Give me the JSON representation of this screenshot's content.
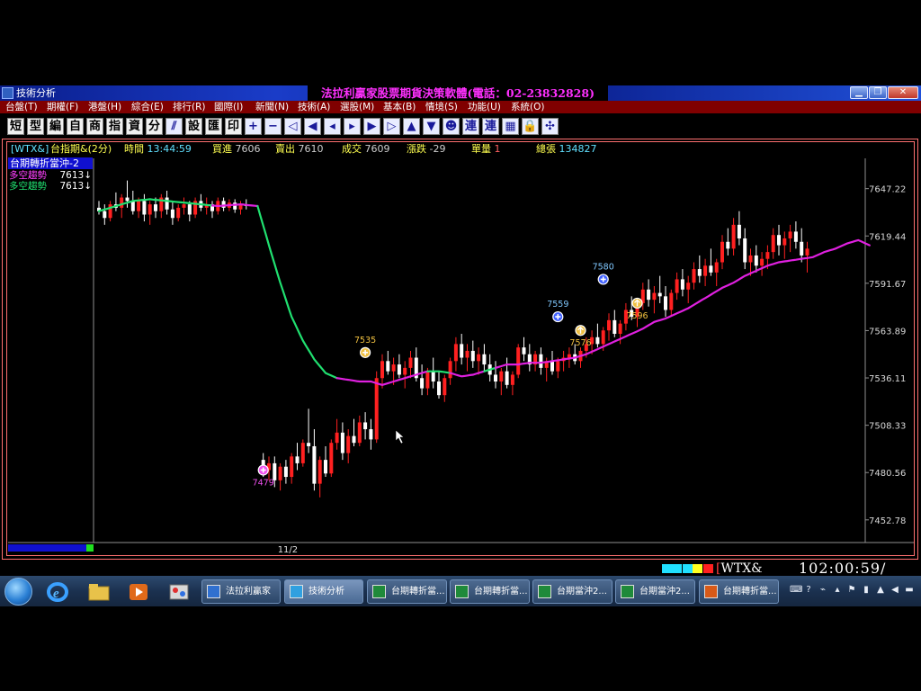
{
  "window": {
    "title": "技術分析",
    "banner": "法拉利贏家股票期貨決策軟體(電話：02-23832828)"
  },
  "menu": [
    "台盤(T)",
    "期權(F)",
    "港盤(H)",
    "綜合(E)",
    "排行(R)",
    "國際(I)",
    "新聞(N)",
    "技術(A)",
    "選股(M)",
    "基本(B)",
    "情境(S)",
    "功能(U)",
    "系統(O)"
  ],
  "toolbar": {
    "text_buttons": [
      "短",
      "型",
      "編",
      "自",
      "商",
      "指",
      "資",
      "分"
    ],
    "text_buttons2": [
      "設",
      "匯",
      "印"
    ],
    "text_buttons3": [
      "連",
      "連"
    ]
  },
  "infobar": {
    "symbol": "[WTX&]",
    "name": "台指期&(2分)",
    "time_label": "時間",
    "time_value": "13:44:59",
    "bid_label": "買進",
    "bid_value": "7606",
    "ask_label": "賣出",
    "ask_value": "7610",
    "trade_label": "成交",
    "trade_value": "7609",
    "change_label": "漲跌",
    "change_value": "-29",
    "volume_label": "單量",
    "volume_value": "1",
    "total_label": "總張",
    "total_value": "134827"
  },
  "indicator": {
    "title": "台期轉折當沖-2",
    "rows": [
      {
        "label": "多空趨勢",
        "value": "7613↓"
      },
      {
        "label": "多空趨勢",
        "value": "7613↓"
      }
    ]
  },
  "chart_data": {
    "type": "candlestick",
    "symbol": "WTX&",
    "interval": "2分",
    "ylim": [
      7440,
      7665
    ],
    "yticks": [
      7647.22,
      7619.44,
      7591.67,
      7563.89,
      7536.11,
      7508.33,
      7480.56,
      7452.78
    ],
    "xtick_labels": [
      {
        "label": "11/2",
        "index": 29
      }
    ],
    "trend_line": [
      [
        0,
        7634
      ],
      [
        3,
        7637
      ],
      [
        6,
        7640
      ],
      [
        9,
        7641
      ],
      [
        12,
        7640
      ],
      [
        15,
        7639
      ],
      [
        18,
        7638
      ],
      [
        21,
        7637
      ],
      [
        25,
        7638
      ],
      [
        28,
        7637
      ],
      [
        30,
        7614
      ],
      [
        32,
        7592
      ],
      [
        34,
        7572
      ],
      [
        36,
        7558
      ],
      [
        38,
        7547
      ],
      [
        40,
        7539
      ],
      [
        42,
        7536
      ],
      [
        44,
        7535
      ],
      [
        46,
        7534
      ],
      [
        48,
        7534
      ],
      [
        50,
        7532
      ],
      [
        52,
        7534
      ],
      [
        54,
        7536
      ],
      [
        56,
        7538
      ],
      [
        58,
        7540
      ],
      [
        60,
        7540
      ],
      [
        62,
        7539
      ],
      [
        64,
        7537
      ],
      [
        66,
        7538
      ],
      [
        68,
        7540
      ],
      [
        70,
        7542
      ],
      [
        72,
        7544
      ],
      [
        74,
        7544
      ],
      [
        76,
        7545
      ],
      [
        78,
        7545
      ],
      [
        80,
        7546
      ],
      [
        82,
        7547
      ],
      [
        84,
        7548
      ],
      [
        86,
        7550
      ],
      [
        88,
        7553
      ],
      [
        90,
        7556
      ],
      [
        92,
        7559
      ],
      [
        94,
        7562
      ],
      [
        96,
        7565
      ],
      [
        98,
        7569
      ],
      [
        100,
        7571
      ],
      [
        102,
        7574
      ],
      [
        104,
        7577
      ],
      [
        106,
        7581
      ],
      [
        108,
        7585
      ],
      [
        110,
        7589
      ],
      [
        112,
        7592
      ],
      [
        114,
        7596
      ],
      [
        116,
        7599
      ],
      [
        118,
        7602
      ],
      [
        120,
        7604
      ],
      [
        122,
        7605
      ],
      [
        124,
        7606
      ],
      [
        126,
        7607
      ],
      [
        128,
        7610
      ],
      [
        130,
        7612
      ],
      [
        132,
        7615
      ],
      [
        134,
        7617
      ],
      [
        136,
        7614
      ]
    ],
    "trend_segments": [
      {
        "start": 0,
        "end": 20,
        "color": "#20e070"
      },
      {
        "start": 20,
        "end": 28,
        "color": "#e020e0"
      },
      {
        "start": 28,
        "end": 42,
        "color": "#20e070"
      },
      {
        "start": 42,
        "end": 58,
        "color": "#e020e0"
      },
      {
        "start": 58,
        "end": 62,
        "color": "#20e070"
      },
      {
        "start": 62,
        "end": 68,
        "color": "#e020e0"
      },
      {
        "start": 68,
        "end": 70,
        "color": "#20e070"
      },
      {
        "start": 70,
        "end": 136,
        "color": "#e020e0"
      }
    ],
    "candles_first": [
      [
        7636,
        7640,
        7632,
        7634
      ],
      [
        7634,
        7638,
        7626,
        7630
      ],
      [
        7630,
        7640,
        7628,
        7638
      ],
      [
        7638,
        7645,
        7634,
        7636
      ],
      [
        7636,
        7644,
        7630,
        7642
      ],
      [
        7642,
        7652,
        7636,
        7640
      ],
      [
        7640,
        7646,
        7632,
        7634
      ],
      [
        7634,
        7642,
        7630,
        7640
      ],
      [
        7640,
        7644,
        7628,
        7632
      ],
      [
        7632,
        7640,
        7626,
        7638
      ],
      [
        7638,
        7642,
        7630,
        7634
      ],
      [
        7634,
        7644,
        7630,
        7642
      ],
      [
        7642,
        7646,
        7632,
        7635
      ],
      [
        7635,
        7640,
        7626,
        7630
      ],
      [
        7630,
        7638,
        7628,
        7636
      ],
      [
        7636,
        7642,
        7632,
        7638
      ],
      [
        7638,
        7640,
        7628,
        7632
      ],
      [
        7632,
        7642,
        7630,
        7640
      ],
      [
        7640,
        7644,
        7634,
        7636
      ],
      [
        7636,
        7642,
        7632,
        7638
      ],
      [
        7638,
        7640,
        7630,
        7634
      ],
      [
        7634,
        7642,
        7632,
        7640
      ],
      [
        7640,
        7642,
        7634,
        7636
      ],
      [
        7636,
        7641,
        7634,
        7639
      ],
      [
        7639,
        7641,
        7633,
        7635
      ],
      [
        7635,
        7640,
        7632,
        7638
      ],
      [
        7638,
        7641,
        7635,
        7637
      ]
    ],
    "candles_second": [
      [
        7488,
        7492,
        7478,
        7482
      ],
      [
        7482,
        7490,
        7476,
        7486
      ],
      [
        7486,
        7490,
        7472,
        7476
      ],
      [
        7476,
        7486,
        7470,
        7484
      ],
      [
        7484,
        7488,
        7474,
        7478
      ],
      [
        7478,
        7492,
        7474,
        7490
      ],
      [
        7490,
        7498,
        7482,
        7486
      ],
      [
        7486,
        7500,
        7484,
        7498
      ],
      [
        7498,
        7518,
        7492,
        7496
      ],
      [
        7496,
        7506,
        7470,
        7474
      ],
      [
        7474,
        7490,
        7466,
        7488
      ],
      [
        7488,
        7496,
        7478,
        7480
      ],
      [
        7480,
        7500,
        7478,
        7498
      ],
      [
        7498,
        7512,
        7494,
        7504
      ],
      [
        7504,
        7510,
        7488,
        7492
      ],
      [
        7492,
        7506,
        7486,
        7502
      ],
      [
        7502,
        7512,
        7496,
        7498
      ],
      [
        7498,
        7514,
        7496,
        7510
      ],
      [
        7510,
        7516,
        7500,
        7506
      ],
      [
        7506,
        7512,
        7494,
        7500
      ],
      [
        7500,
        7540,
        7498,
        7536
      ],
      [
        7536,
        7550,
        7530,
        7546
      ],
      [
        7546,
        7552,
        7538,
        7540
      ],
      [
        7540,
        7548,
        7532,
        7544
      ],
      [
        7544,
        7550,
        7536,
        7538
      ],
      [
        7538,
        7546,
        7530,
        7542
      ],
      [
        7542,
        7552,
        7536,
        7548
      ],
      [
        7548,
        7554,
        7534,
        7536
      ],
      [
        7536,
        7544,
        7526,
        7530
      ],
      [
        7530,
        7542,
        7526,
        7540
      ],
      [
        7540,
        7548,
        7530,
        7534
      ],
      [
        7534,
        7540,
        7524,
        7526
      ],
      [
        7526,
        7538,
        7522,
        7536
      ],
      [
        7536,
        7548,
        7532,
        7546
      ],
      [
        7546,
        7560,
        7540,
        7556
      ],
      [
        7556,
        7562,
        7544,
        7548
      ],
      [
        7548,
        7556,
        7540,
        7552
      ],
      [
        7552,
        7558,
        7542,
        7546
      ],
      [
        7546,
        7554,
        7538,
        7550
      ],
      [
        7550,
        7556,
        7540,
        7544
      ],
      [
        7544,
        7550,
        7534,
        7538
      ],
      [
        7538,
        7546,
        7530,
        7534
      ],
      [
        7534,
        7542,
        7526,
        7540
      ],
      [
        7540,
        7548,
        7530,
        7532
      ],
      [
        7532,
        7540,
        7526,
        7538
      ],
      [
        7538,
        7556,
        7536,
        7554
      ],
      [
        7554,
        7560,
        7546,
        7550
      ],
      [
        7550,
        7556,
        7540,
        7544
      ],
      [
        7544,
        7552,
        7540,
        7550
      ],
      [
        7550,
        7554,
        7538,
        7542
      ],
      [
        7542,
        7548,
        7534,
        7546
      ],
      [
        7546,
        7552,
        7538,
        7540
      ],
      [
        7540,
        7548,
        7536,
        7546
      ],
      [
        7546,
        7552,
        7540,
        7548
      ],
      [
        7548,
        7554,
        7542,
        7550
      ],
      [
        7550,
        7556,
        7544,
        7546
      ],
      [
        7546,
        7554,
        7542,
        7552
      ],
      [
        7552,
        7560,
        7548,
        7556
      ],
      [
        7556,
        7564,
        7550,
        7560
      ],
      [
        7560,
        7568,
        7554,
        7556
      ],
      [
        7556,
        7566,
        7552,
        7564
      ],
      [
        7564,
        7574,
        7558,
        7570
      ],
      [
        7570,
        7576,
        7560,
        7562
      ],
      [
        7562,
        7570,
        7556,
        7568
      ],
      [
        7568,
        7580,
        7564,
        7576
      ],
      [
        7576,
        7584,
        7570,
        7572
      ],
      [
        7572,
        7582,
        7566,
        7580
      ],
      [
        7580,
        7592,
        7576,
        7588
      ],
      [
        7588,
        7594,
        7578,
        7582
      ],
      [
        7582,
        7590,
        7574,
        7586
      ],
      [
        7586,
        7596,
        7580,
        7584
      ],
      [
        7584,
        7590,
        7572,
        7576
      ],
      [
        7576,
        7588,
        7572,
        7586
      ],
      [
        7586,
        7598,
        7582,
        7594
      ],
      [
        7594,
        7600,
        7584,
        7588
      ],
      [
        7588,
        7596,
        7580,
        7592
      ],
      [
        7592,
        7604,
        7588,
        7600
      ],
      [
        7600,
        7608,
        7592,
        7596
      ],
      [
        7596,
        7606,
        7590,
        7602
      ],
      [
        7602,
        7612,
        7596,
        7598
      ],
      [
        7598,
        7606,
        7590,
        7604
      ],
      [
        7604,
        7620,
        7600,
        7616
      ],
      [
        7616,
        7624,
        7608,
        7612
      ],
      [
        7612,
        7630,
        7608,
        7626
      ],
      [
        7626,
        7634,
        7614,
        7618
      ],
      [
        7618,
        7624,
        7600,
        7604
      ],
      [
        7604,
        7612,
        7596,
        7608
      ],
      [
        7608,
        7614,
        7598,
        7602
      ],
      [
        7602,
        7610,
        7596,
        7606
      ],
      [
        7606,
        7614,
        7600,
        7610
      ],
      [
        7610,
        7624,
        7606,
        7620
      ],
      [
        7620,
        7626,
        7608,
        7614
      ],
      [
        7614,
        7622,
        7606,
        7618
      ],
      [
        7618,
        7626,
        7610,
        7622
      ],
      [
        7622,
        7628,
        7612,
        7616
      ],
      [
        7616,
        7624,
        7604,
        7608
      ],
      [
        7608,
        7616,
        7598,
        7612
      ]
    ],
    "annotations": [
      {
        "label": "7479",
        "index": 29,
        "value": 7482,
        "label_pos": "below",
        "marker": "plus",
        "color": "#f050f0",
        "text_color": "#f050f0"
      },
      {
        "label": "7535",
        "index": 47,
        "value": 7551,
        "label_pos": "above",
        "marker": "plus",
        "color": "#f0c040",
        "text_color": "#f0c040"
      },
      {
        "label": "7559",
        "index": 81,
        "value": 7572,
        "label_pos": "above",
        "marker": "plus",
        "color": "#4060ff",
        "text_color": "#80c8ff"
      },
      {
        "label": "7576",
        "index": 85,
        "value": 7564,
        "label_pos": "below",
        "marker": "up",
        "color": "#f0c040",
        "text_color": "#f0c040"
      },
      {
        "label": "7580",
        "index": 89,
        "value": 7594,
        "label_pos": "above",
        "marker": "plus",
        "color": "#4060ff",
        "text_color": "#80c8ff"
      },
      {
        "label": "7596",
        "index": 95,
        "value": 7580,
        "label_pos": "below",
        "marker": "up",
        "color": "#f0c040",
        "text_color": "#f0c040"
      }
    ]
  },
  "statusbar": {
    "ticker": "WTX&",
    "clock": "102:00:59/",
    "colors": [
      "#20e0ff",
      "#20e0ff",
      "#20e0ff",
      "#ffff20",
      "#ff2020"
    ]
  },
  "taskbar": {
    "items": [
      {
        "label": "法拉利贏家",
        "icon": "ferrari-app-icon",
        "active": false
      },
      {
        "label": "技術分析",
        "icon": "chart-app-icon",
        "active": true
      },
      {
        "label": "台期轉折當...",
        "icon": "excel-icon",
        "active": false
      },
      {
        "label": "台期轉折當...",
        "icon": "excel-icon",
        "active": false
      },
      {
        "label": "台期當沖2...",
        "icon": "excel-icon",
        "active": false
      },
      {
        "label": "台期當沖2...",
        "icon": "excel-icon",
        "active": false
      },
      {
        "label": "台期轉折當...",
        "icon": "powerpoint-icon",
        "active": false
      }
    ]
  }
}
